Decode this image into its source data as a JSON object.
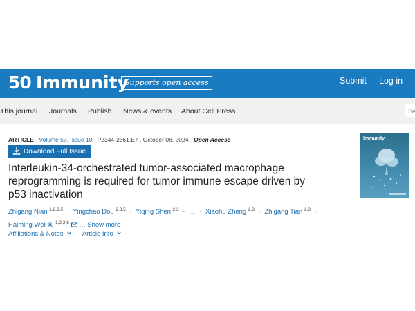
{
  "header": {
    "logo_number": "50",
    "logo_name": "Immunity",
    "open_access_label": "Supports open access",
    "submit_label": "Submit",
    "login_label": "Log in"
  },
  "nav": {
    "items": [
      "This journal",
      "Journals",
      "Publish",
      "News & events",
      "About Cell Press"
    ],
    "search_placeholder": "Sea"
  },
  "article": {
    "kind": "ARTICLE",
    "volume": "Volume 57, Issue 10",
    "pages": "P2344-2361.E7",
    "date": "October 08, 2024",
    "access": "Open Access",
    "download_label": "Download Full Issue",
    "title": "Interleukin-34-orchestrated tumor-associated macrophage reprogramming is required for tumor immune escape driven by p53 inactivation"
  },
  "authors": [
    {
      "name": "Zhigang Nian",
      "sup": "1,2,3,5"
    },
    {
      "name": "Yingchao Dou",
      "sup": "2,3,5"
    },
    {
      "name": "Yiqing Shen",
      "sup": "2,3"
    },
    {
      "name": "Xiaohu Zheng",
      "sup": "2,3"
    },
    {
      "name": "Zhigang Tian",
      "sup": "2,3"
    },
    {
      "name": "Haiming Wei",
      "sup": "1,2,3,6"
    }
  ],
  "authors_ellipsis": "…",
  "show_more_label": "… Show more",
  "tabs": {
    "affiliations_label": "Affiliations & Notes",
    "article_info_label": "Article Info"
  },
  "cover": {
    "title": "Immunity"
  },
  "colors": {
    "brand_blue": "#1a7bc0",
    "link_blue": "#1a6fb0",
    "nav_bg": "#f1f1f1"
  }
}
